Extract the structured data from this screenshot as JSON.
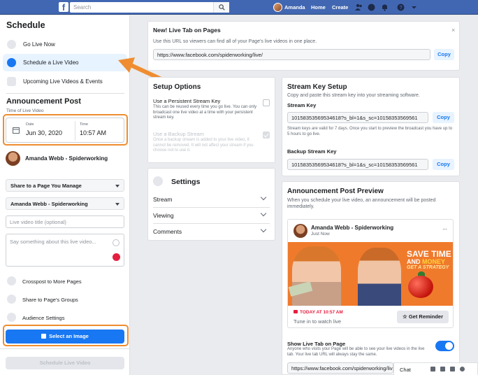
{
  "topbar": {
    "logo": "f",
    "search_placeholder": "Search",
    "user_name": "Amanda",
    "home": "Home",
    "create": "Create"
  },
  "sidebar": {
    "title": "Schedule",
    "nav": [
      {
        "label": "Go Live Now",
        "icon": "video-camera-icon"
      },
      {
        "label": "Schedule a Live Video",
        "icon": "clock-icon"
      },
      {
        "label": "Upcoming Live Videos & Events",
        "icon": "calendar-icon"
      }
    ],
    "announcement_title": "Announcement Post",
    "time_subtitle": "Time of Live Video",
    "date_label": "Date",
    "date_value": "Jun 30, 2020",
    "time_label": "Time",
    "time_value": "10:57 AM",
    "account_name": "Amanda Webb - Spiderworking",
    "share_dropdown": "Share to a Page You Manage",
    "page_dropdown": "Amanda Webb - Spiderworking",
    "title_placeholder": "Live video title (optional)",
    "desc_placeholder": "Say something about this live video...",
    "options": [
      {
        "label": "Crosspost to More Pages",
        "icon": "crosspost-icon"
      },
      {
        "label": "Share to Page's Groups",
        "icon": "groups-icon"
      },
      {
        "label": "Audience Settings",
        "icon": "audience-icon"
      }
    ],
    "select_image": "Select an Image",
    "schedule_button": "Schedule Live Video"
  },
  "live_tab_banner": {
    "title": "New! Live Tab on Pages",
    "desc": "Use this URL so viewers can find all of your Page's live videos in one place.",
    "url": "https://www.facebook.com/spiderworking/live/",
    "copy": "Copy",
    "close": "×"
  },
  "setup_options": {
    "title": "Setup Options",
    "persistent_title": "Use a Persistent Stream Key",
    "persistent_desc": "This can be reused every time you go live. You can only broadcast one live video at a time with your persistent stream key.",
    "backup_title": "Use a Backup Stream",
    "backup_desc": "Once a backup stream is added to your live video, it cannot be removed. It will not affect your stream if you choose not to use it."
  },
  "settings": {
    "title": "Settings",
    "rows": [
      "Stream",
      "Viewing",
      "Comments"
    ]
  },
  "stream_key": {
    "title": "Stream Key Setup",
    "desc": "Copy and paste this stream key into your streaming software.",
    "key_label": "Stream Key",
    "key_value": "10158353569534618?s_bl=1&s_sc=10158353569561",
    "key_note": "Stream keys are valid for 7 days. Once you start to preview the broadcast you have up to 5 hours to go live.",
    "backup_label": "Backup Stream Key",
    "backup_value": "10158353569534618?s_bl=1&s_sc=10158353569561",
    "copy": "Copy"
  },
  "preview": {
    "title": "Announcement Post Preview",
    "desc": "When you schedule your live video, an announcement will be posted immediately.",
    "post_name": "Amanda Webb - Spiderworking",
    "post_time": "Just Now",
    "more": "···",
    "thumb_line1": "SAVE TIME",
    "thumb_and": "AND",
    "thumb_money": "MONEY",
    "thumb_line3": "GET A STRATEGY",
    "live_time": "TODAY AT 10:57 AM",
    "tune_in": "Tune in to watch live",
    "reminder": "Get Reminder"
  },
  "show_live_tab": {
    "title": "Show Live Tab on Page",
    "desc": "Anyone who visits your Page will be able to see your live videos in the live tab. Your live tab URL will always stay the same.",
    "url": "https://www.facebook.com/spiderworking/live/"
  },
  "chat": {
    "label": "Chat"
  },
  "colors": {
    "fb_blue": "#4267b2",
    "accent": "#1877f2",
    "highlight": "#ef8d30"
  }
}
